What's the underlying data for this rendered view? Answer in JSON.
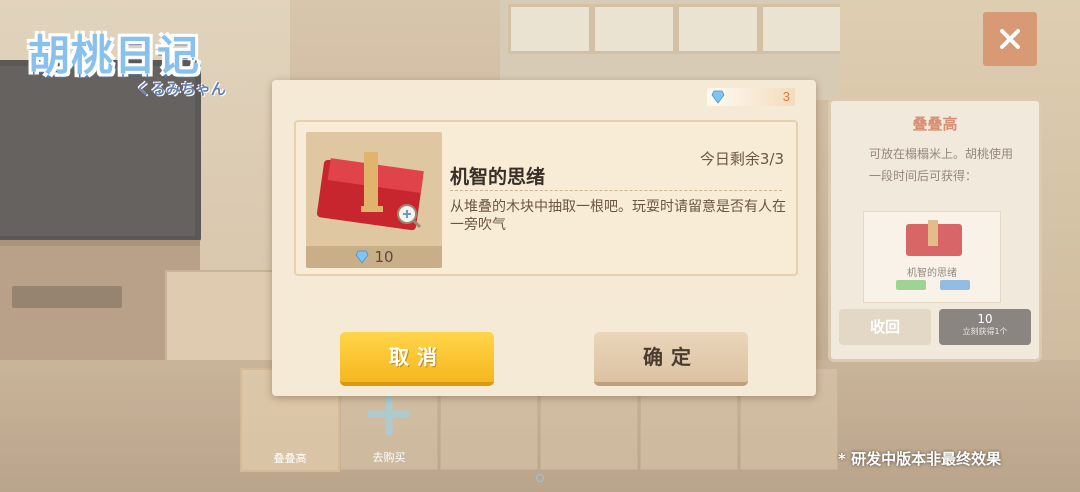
{
  "game": {
    "logo_text": "胡桃日记",
    "logo_sub": "くるみちゃん"
  },
  "background_panel": {
    "title": "叠叠高",
    "desc": "可放在榻榻米上。胡桃使用一段时间后可获得：",
    "reward_name": "机智的思绪",
    "recall_label": "收回",
    "buy_value": "10",
    "buy_note": "立刻获得1个"
  },
  "slots": [
    {
      "label": "叠叠高"
    },
    {
      "label": "去购买"
    },
    {
      "label": ""
    },
    {
      "label": ""
    },
    {
      "label": ""
    },
    {
      "label": ""
    }
  ],
  "dialog": {
    "gem_count": "3",
    "item": {
      "title": "机智的思绪",
      "remaining": "今日剩余3/3",
      "description": "从堆叠的木块中抽取一根吧。玩耍时请留意是否有人在一旁吹气",
      "price": "10"
    },
    "cancel_label": "取消",
    "confirm_label": "确定"
  },
  "disclaimer": "* 研发中版本非最终效果",
  "colors": {
    "accent_orange": "#c8733f",
    "cancel_yellow": "#f6b71f",
    "gem_blue": "#7fc4f2"
  },
  "icons": {
    "close": "close-icon",
    "gem": "diamond-icon",
    "zoom": "magnifier-icon"
  }
}
